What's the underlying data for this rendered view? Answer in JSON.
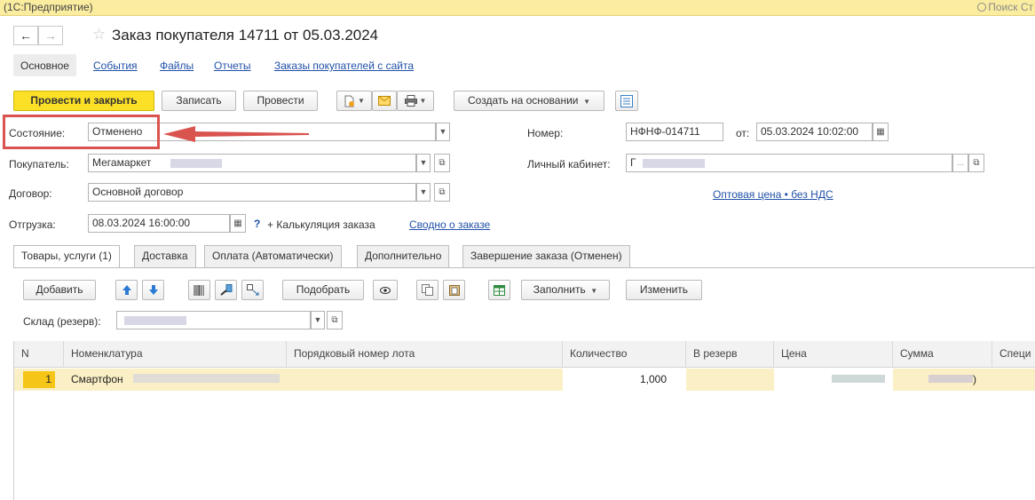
{
  "app_title": "(1С:Предприятие)",
  "search_placeholder": "Поиск Ст",
  "document_title": "Заказ покупателя 14711 от 05.03.2024",
  "nav_tabs": [
    "Основное",
    "События",
    "Файлы",
    "Отчеты",
    "Заказы покупателей с сайта"
  ],
  "toolbar": {
    "post_close": "Провести и закрыть",
    "save": "Записать",
    "post": "Провести",
    "create_based": "Создать на основании"
  },
  "fields": {
    "state_label": "Состояние:",
    "state_value": "Отменено",
    "buyer_label": "Покупатель:",
    "buyer_value": "Мегамаркет",
    "contract_label": "Договор:",
    "contract_value": "Основной договор",
    "shipment_label": "Отгрузка:",
    "shipment_value": "08.03.2024 16:00:00",
    "help_mark": "?",
    "calc_link": "+ Калькуляция заказа",
    "summary_link": "Сводно о заказе",
    "number_label": "Номер:",
    "number_value": "НФНФ-014711",
    "from_label": "от:",
    "date_value": "05.03.2024 10:02:00",
    "cabinet_label": "Личный кабинет:",
    "cabinet_value": "Г",
    "price_link": "Оптовая цена • без НДС"
  },
  "tabs": [
    "Товары, услуги (1)",
    "Доставка",
    "Оплата (Автоматически)",
    "Дополнительно",
    "Завершение заказа (Отменен)"
  ],
  "table_toolbar": {
    "add": "Добавить",
    "select": "Подобрать",
    "fill": "Заполнить",
    "change": "Изменить"
  },
  "warehouse_label": "Склад (резерв):",
  "columns": [
    "N",
    "Номенклатура",
    "Порядковый номер лота",
    "Количество",
    "В резерв",
    "Цена",
    "Сумма",
    "Специ"
  ],
  "rows": [
    {
      "n": "1",
      "item": "Смартфон",
      "lot": "",
      "qty": "1,000",
      "reserve": "",
      "price": "",
      "sum": ")"
    }
  ],
  "colors": {
    "accent_yellow": "#fbe027",
    "title_bar": "#fbeda0",
    "highlight_red": "#d9534f",
    "link_blue": "#2151a8",
    "row_selected": "#fbf0c5"
  }
}
